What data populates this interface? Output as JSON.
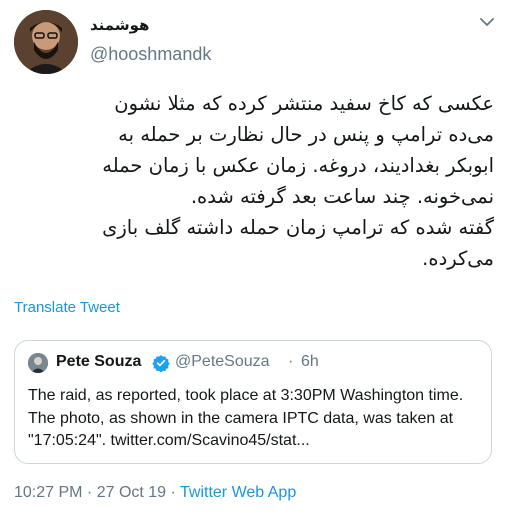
{
  "author": {
    "display_name": "هوشمند",
    "username": "@hooshmandk"
  },
  "tweet": {
    "text": "عکسی که کاخ سفید منتشر کرده که مثلا نشون\nمی‌ده ترامپ و پنس در حال نظارت بر حمله به\nابوبکر بغدادیند، دروغه. زمان عکس با زمان حمله\nنمی‌خونه. چند ساعت بعد گرفته شده.\nگفته شده که ترامپ زمان حمله داشته گلف بازی\nمی‌کرده.",
    "translate_label": "Translate Tweet"
  },
  "quoted_tweet": {
    "display_name": "Pete Souza",
    "verified": true,
    "username": "@PeteSouza",
    "separator": "·",
    "time": "6h",
    "text": "The raid, as reported, took place at 3:30PM Washington time. The photo, as shown in the camera IPTC data, was taken at \"17:05:24\". twitter.com/Scavino45/stat..."
  },
  "meta": {
    "timestamp": "10:27 PM · 27 Oct 19 · ",
    "source": "Twitter Web App"
  },
  "colors": {
    "link": "#1b95e0",
    "secondary_text": "#657786",
    "border": "#ccd6dd",
    "verified": "#1da1f2"
  },
  "icons": {
    "menu": "chevron-down-icon",
    "verified": "verified-badge-icon"
  }
}
